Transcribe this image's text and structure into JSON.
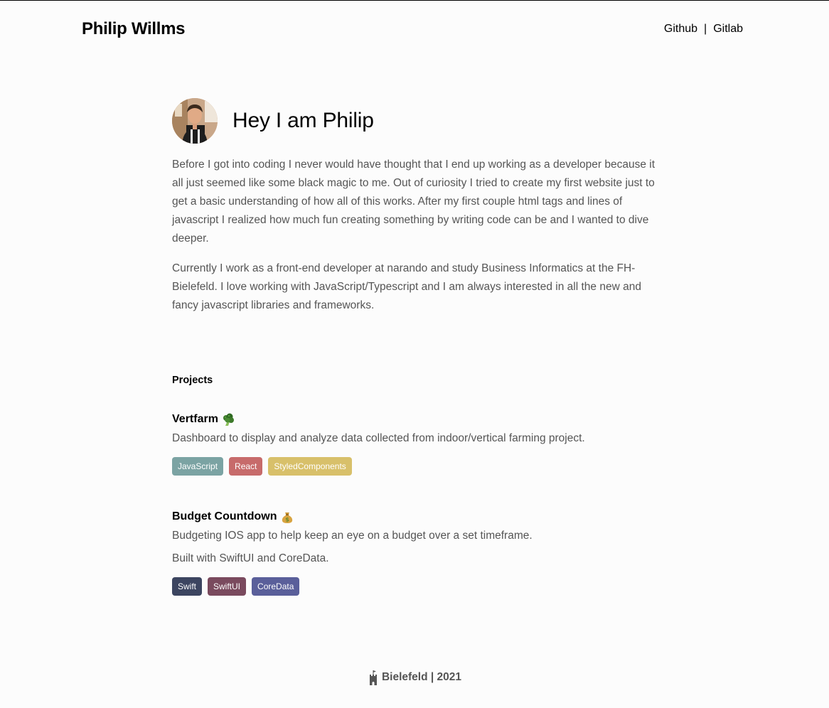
{
  "header": {
    "brand": "Philip Willms",
    "nav": [
      {
        "label": "Github"
      },
      {
        "label": "Gitlab"
      }
    ],
    "separator": "|"
  },
  "hero": {
    "greeting": "Hey I am Philip"
  },
  "intro": {
    "paragraph1": "Before I got into coding I never would have thought that I end up working as a developer because it all just seemed like some black magic to me. Out of curiosity I tried to create my first website just to get a basic understanding of how all of this works. After my first couple html tags and lines of javascript I realized how much fun creating something by writing code can be and I wanted to dive deeper.",
    "paragraph2": "Currently I work as a front-end developer at narando and study Business Informatics at the FH-Bielefeld. I love working with JavaScript/Typescript and I am always interested in all the new and fancy javascript libraries and frameworks."
  },
  "projects": {
    "title": "Projects",
    "items": [
      {
        "name": "Vertfarm",
        "emoji_icon": "broccoli-icon",
        "descriptions": [
          "Dashboard to display and analyze data collected from indoor/vertical farming project."
        ],
        "tags": [
          {
            "label": "JavaScript",
            "color": "#7ba3a3"
          },
          {
            "label": "React",
            "color": "#c76b6b"
          },
          {
            "label": "StyledComponents",
            "color": "#d8c06a"
          }
        ]
      },
      {
        "name": "Budget Countdown",
        "emoji_icon": "money-bag-icon",
        "descriptions": [
          "Budgeting IOS app to help keep an eye on a budget over a set timeframe.",
          "Built with SwiftUI and CoreData."
        ],
        "tags": [
          {
            "label": "Swift",
            "color": "#3c4560"
          },
          {
            "label": "SwiftUI",
            "color": "#7a4a5e"
          },
          {
            "label": "CoreData",
            "color": "#5a5f9a"
          }
        ]
      }
    ]
  },
  "footer": {
    "icon": "castle-icon",
    "text": "Bielefeld | 2021"
  }
}
